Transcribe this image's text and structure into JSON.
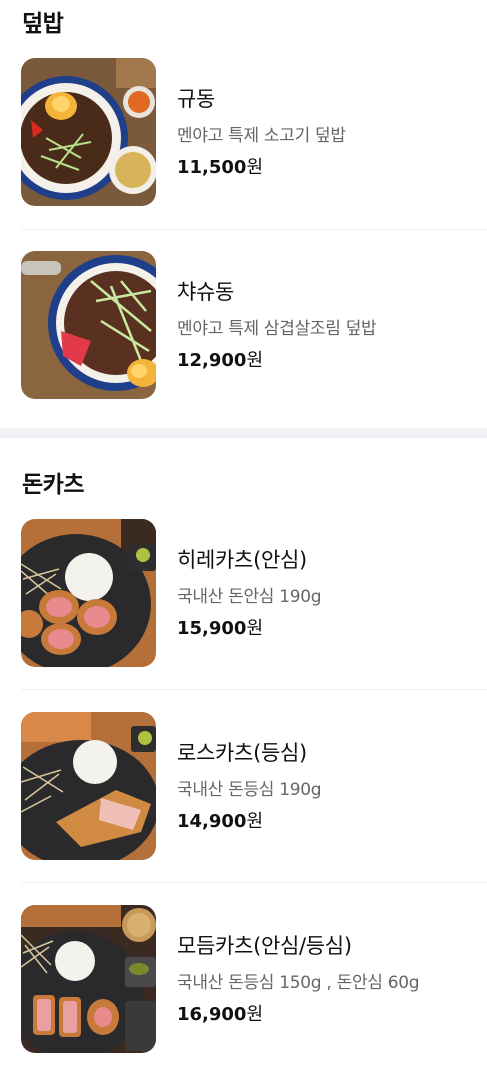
{
  "sections": [
    {
      "title": "덮밥",
      "items": [
        {
          "name": "규동",
          "desc": "멘야고 특제 소고기 덮밥",
          "price": "11,500",
          "unit": "원",
          "image": "gyudon-photo"
        },
        {
          "name": "챠슈동",
          "desc": "멘야고 특제 삼겹살조림 덮밥",
          "price": "12,900",
          "unit": "원",
          "image": "chashudon-photo"
        }
      ]
    },
    {
      "title": "돈카츠",
      "items": [
        {
          "name": "히레카츠(안심)",
          "desc": "국내산 돈안심 190g",
          "price": "15,900",
          "unit": "원",
          "image": "hirekatsu-photo"
        },
        {
          "name": "로스카츠(등심)",
          "desc": "국내산 돈등심 190g",
          "price": "14,900",
          "unit": "원",
          "image": "rosukatsu-photo"
        },
        {
          "name": "모듬카츠(안심/등심)",
          "desc": "국내산 돈등심 150g , 돈안심 60g",
          "price": "16,900",
          "unit": "원",
          "image": "modeum-katsu-photo"
        }
      ]
    }
  ]
}
